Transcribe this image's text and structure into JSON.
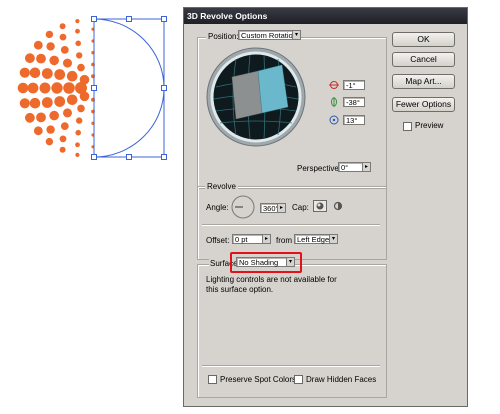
{
  "dialog": {
    "title": "3D Revolve Options"
  },
  "position": {
    "label": "Position:",
    "value": "Custom Rotation",
    "rot_x": "-1°",
    "rot_y": "-38°",
    "rot_z": "13°",
    "perspective_label": "Perspective:",
    "perspective_value": "0°"
  },
  "buttons": {
    "ok": "OK",
    "cancel": "Cancel",
    "map_art": "Map Art...",
    "fewer": "Fewer Options"
  },
  "preview": {
    "label": "Preview",
    "checked": false
  },
  "revolve": {
    "title": "Revolve",
    "angle_label": "Angle:",
    "angle_value": "360°",
    "cap_label": "Cap:",
    "offset_label": "Offset:",
    "offset_value": "0 pt",
    "from_label": "from",
    "from_value": "Left Edge"
  },
  "surface": {
    "label": "Surface:",
    "value": "No Shading",
    "message": "Lighting controls are not available for this surface option."
  },
  "bottom": {
    "preserve_spot": "Preserve Spot Colors",
    "draw_hidden": "Draw Hidden Faces"
  },
  "colors": {
    "accent": "#ee6a2c",
    "selection": "#3b64d8",
    "highlight": "#e3121a",
    "sphere": "#6ec3d6"
  },
  "icons": {
    "x_axis": "rotate-x-icon",
    "y_axis": "rotate-y-icon",
    "z_axis": "rotate-z-icon"
  }
}
